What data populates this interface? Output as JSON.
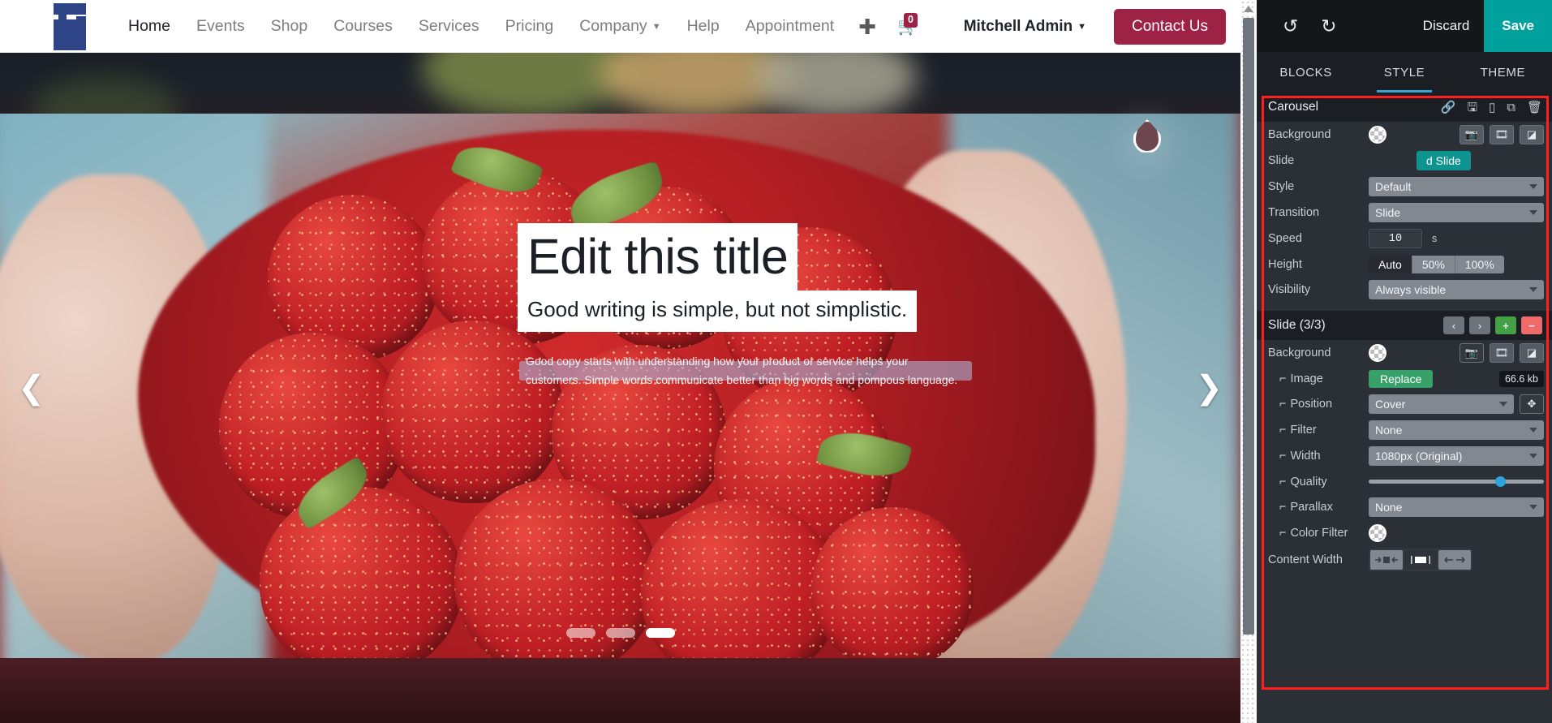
{
  "website": {
    "logo_icon": "sr-logo-icon",
    "nav": [
      {
        "label": "Home",
        "active": true,
        "caret": false
      },
      {
        "label": "Events",
        "active": false,
        "caret": false
      },
      {
        "label": "Shop",
        "active": false,
        "caret": false
      },
      {
        "label": "Courses",
        "active": false,
        "caret": false
      },
      {
        "label": "Services",
        "active": false,
        "caret": false
      },
      {
        "label": "Pricing",
        "active": false,
        "caret": false
      },
      {
        "label": "Company",
        "active": false,
        "caret": true
      },
      {
        "label": "Help",
        "active": false,
        "caret": false
      },
      {
        "label": "Appointment",
        "active": false,
        "caret": false
      }
    ],
    "add_page_icon": "plus-icon",
    "cart": {
      "icon": "cart-icon",
      "count": "0"
    },
    "user": {
      "name": "Mitchell Admin",
      "caret_icon": "chevron-down-icon"
    },
    "contact_button": "Contact Us",
    "accent_color": "#9e2146"
  },
  "hero": {
    "prev_icon": "chevron-left-icon",
    "next_icon": "chevron-right-icon",
    "title": "Edit this title",
    "subtitle": "Good writing is simple, but not simplistic.",
    "paragraph": "Good copy starts with understanding how your product or service helps your customers. Simple words communicate better than big words and pompous language.",
    "indicators": [
      {
        "active": false
      },
      {
        "active": false
      },
      {
        "active": true
      }
    ]
  },
  "editor": {
    "topbar": {
      "undo_icon": "undo-icon",
      "redo_icon": "redo-icon",
      "discard_label": "Discard",
      "save_label": "Save",
      "save_color": "#00a09d"
    },
    "tabs": [
      {
        "label": "BLOCKS",
        "active": false
      },
      {
        "label": "STYLE",
        "active": true
      },
      {
        "label": "THEME",
        "active": false
      }
    ],
    "carousel_section": {
      "title": "Carousel",
      "actions": [
        {
          "icon": "link-icon"
        },
        {
          "icon": "save-disk-icon"
        },
        {
          "icon": "mobile-icon"
        },
        {
          "icon": "duplicate-icon"
        },
        {
          "icon": "trash-icon"
        }
      ],
      "rows": {
        "background": {
          "label": "Background",
          "swatch_icon": "color-swatch-transparent",
          "buttons": [
            {
              "icon": "camera-icon"
            },
            {
              "icon": "video-icon"
            },
            {
              "icon": "gradient-icon"
            }
          ]
        },
        "slide": {
          "label": "Slide",
          "button_label": "Add Slide",
          "button_visible_text": "d Slide",
          "button_color": "#0e9490"
        },
        "style": {
          "label": "Style",
          "value": "Default"
        },
        "transition": {
          "label": "Transition",
          "value": "Slide"
        },
        "speed": {
          "label": "Speed",
          "value": "10",
          "unit": "s"
        },
        "height": {
          "label": "Height",
          "options": [
            "Auto",
            "50%",
            "100%"
          ],
          "selected": "Auto"
        },
        "visibility": {
          "label": "Visibility",
          "value": "Always visible"
        }
      }
    },
    "slide_section": {
      "title": "Slide (3/3)",
      "nav_buttons": [
        {
          "icon": "chevron-left-icon"
        },
        {
          "icon": "chevron-right-icon"
        },
        {
          "icon": "plus-icon",
          "color": "#43a047"
        },
        {
          "icon": "minus-icon",
          "color": "#ef6b6b"
        }
      ],
      "rows": {
        "background": {
          "label": "Background",
          "swatch_icon": "color-swatch-transparent",
          "buttons": [
            {
              "icon": "camera-icon"
            },
            {
              "icon": "video-icon"
            },
            {
              "icon": "gradient-icon"
            }
          ]
        },
        "image": {
          "label": "Image",
          "button_label": "Replace",
          "size": "66.6 kb",
          "button_color": "#38a169"
        },
        "position": {
          "label": "Position",
          "value": "Cover",
          "extra_icon": "move-icon"
        },
        "filter": {
          "label": "Filter",
          "value": "None"
        },
        "width": {
          "label": "Width",
          "value": "1080px (Original)"
        },
        "quality": {
          "label": "Quality",
          "slider_pct": 72
        },
        "parallax": {
          "label": "Parallax",
          "value": "None"
        },
        "color_filter": {
          "label": "Color Filter",
          "swatch_icon": "color-swatch-transparent"
        },
        "content_width": {
          "label": "Content Width",
          "options": [
            {
              "icon": "narrow-width-icon",
              "active": false
            },
            {
              "icon": "medium-width-icon",
              "active": true
            },
            {
              "icon": "full-width-icon",
              "active": false
            }
          ]
        }
      }
    },
    "highlight_color": "#ff1f1f"
  }
}
